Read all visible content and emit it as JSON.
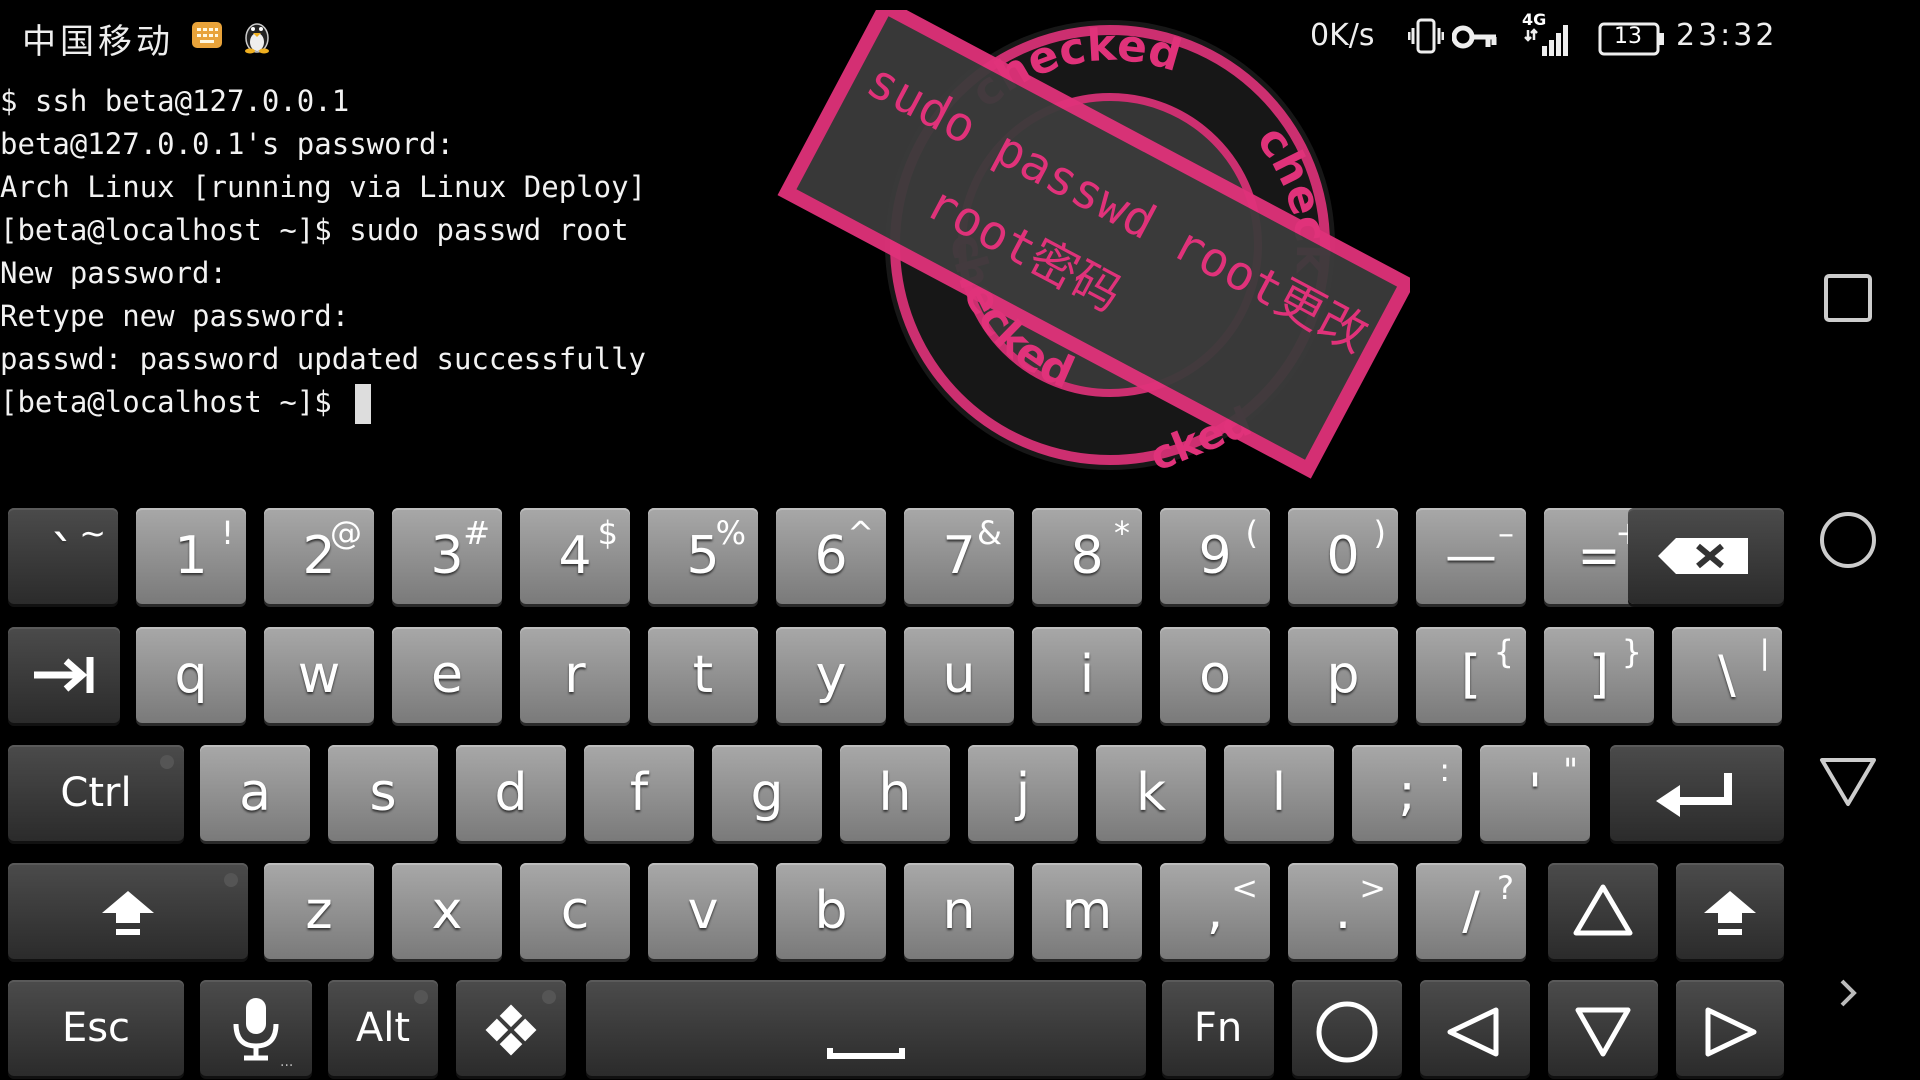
{
  "status": {
    "carrier": "中国移动",
    "net_speed": "0K/s",
    "network": "4G",
    "battery": "13",
    "time": "23:32"
  },
  "terminal": {
    "lines": [
      "$ ssh beta@127.0.0.1",
      "beta@127.0.0.1's password:",
      "Arch Linux [running via Linux Deploy]",
      "[beta@localhost ~]$ sudo passwd root",
      "New password:",
      "Retype new password:",
      "passwd: password updated successfully",
      "[beta@localhost ~]$ "
    ]
  },
  "stamp": {
    "top_text": "checked",
    "side_text": "check",
    "bottom_text": "checked",
    "bottom_text2": "cked",
    "banner_line1": "sudo passwd root更改",
    "banner_line2": "root密码",
    "color": "#e0327a"
  },
  "keyboard": {
    "row1": [
      {
        "main": "`",
        "alt": "~"
      },
      {
        "main": "1",
        "alt": "!"
      },
      {
        "main": "2",
        "alt": "@"
      },
      {
        "main": "3",
        "alt": "#"
      },
      {
        "main": "4",
        "alt": "$"
      },
      {
        "main": "5",
        "alt": "%"
      },
      {
        "main": "6",
        "alt": "^"
      },
      {
        "main": "7",
        "alt": "&"
      },
      {
        "main": "8",
        "alt": "*"
      },
      {
        "main": "9",
        "alt": "("
      },
      {
        "main": "0",
        "alt": ")"
      },
      {
        "main": "—",
        "alt": "–"
      },
      {
        "main": "=",
        "alt": "+"
      }
    ],
    "row2": [
      {
        "main": "q",
        "alt": ""
      },
      {
        "main": "w",
        "alt": ""
      },
      {
        "main": "e",
        "alt": ""
      },
      {
        "main": "r",
        "alt": ""
      },
      {
        "main": "t",
        "alt": ""
      },
      {
        "main": "y",
        "alt": ""
      },
      {
        "main": "u",
        "alt": ""
      },
      {
        "main": "i",
        "alt": ""
      },
      {
        "main": "o",
        "alt": ""
      },
      {
        "main": "p",
        "alt": ""
      },
      {
        "main": "[",
        "alt": "{"
      },
      {
        "main": "]",
        "alt": "}"
      },
      {
        "main": "\\",
        "alt": "|"
      }
    ],
    "row3": [
      {
        "main": "a",
        "alt": ""
      },
      {
        "main": "s",
        "alt": ""
      },
      {
        "main": "d",
        "alt": ""
      },
      {
        "main": "f",
        "alt": ""
      },
      {
        "main": "g",
        "alt": ""
      },
      {
        "main": "h",
        "alt": ""
      },
      {
        "main": "j",
        "alt": ""
      },
      {
        "main": "k",
        "alt": ""
      },
      {
        "main": "l",
        "alt": ""
      },
      {
        "main": ";",
        "alt": ":"
      },
      {
        "main": "'",
        "alt": "\""
      }
    ],
    "row4": [
      {
        "main": "z",
        "alt": ""
      },
      {
        "main": "x",
        "alt": ""
      },
      {
        "main": "c",
        "alt": ""
      },
      {
        "main": "v",
        "alt": ""
      },
      {
        "main": "b",
        "alt": ""
      },
      {
        "main": "n",
        "alt": ""
      },
      {
        "main": "m",
        "alt": ""
      },
      {
        "main": ",",
        "alt": "<"
      },
      {
        "main": ".",
        "alt": ">"
      },
      {
        "main": "/",
        "alt": "?"
      }
    ],
    "ctrl_label": "Ctrl",
    "esc_label": "Esc",
    "alt_label": "Alt",
    "fn_label": "Fn"
  }
}
